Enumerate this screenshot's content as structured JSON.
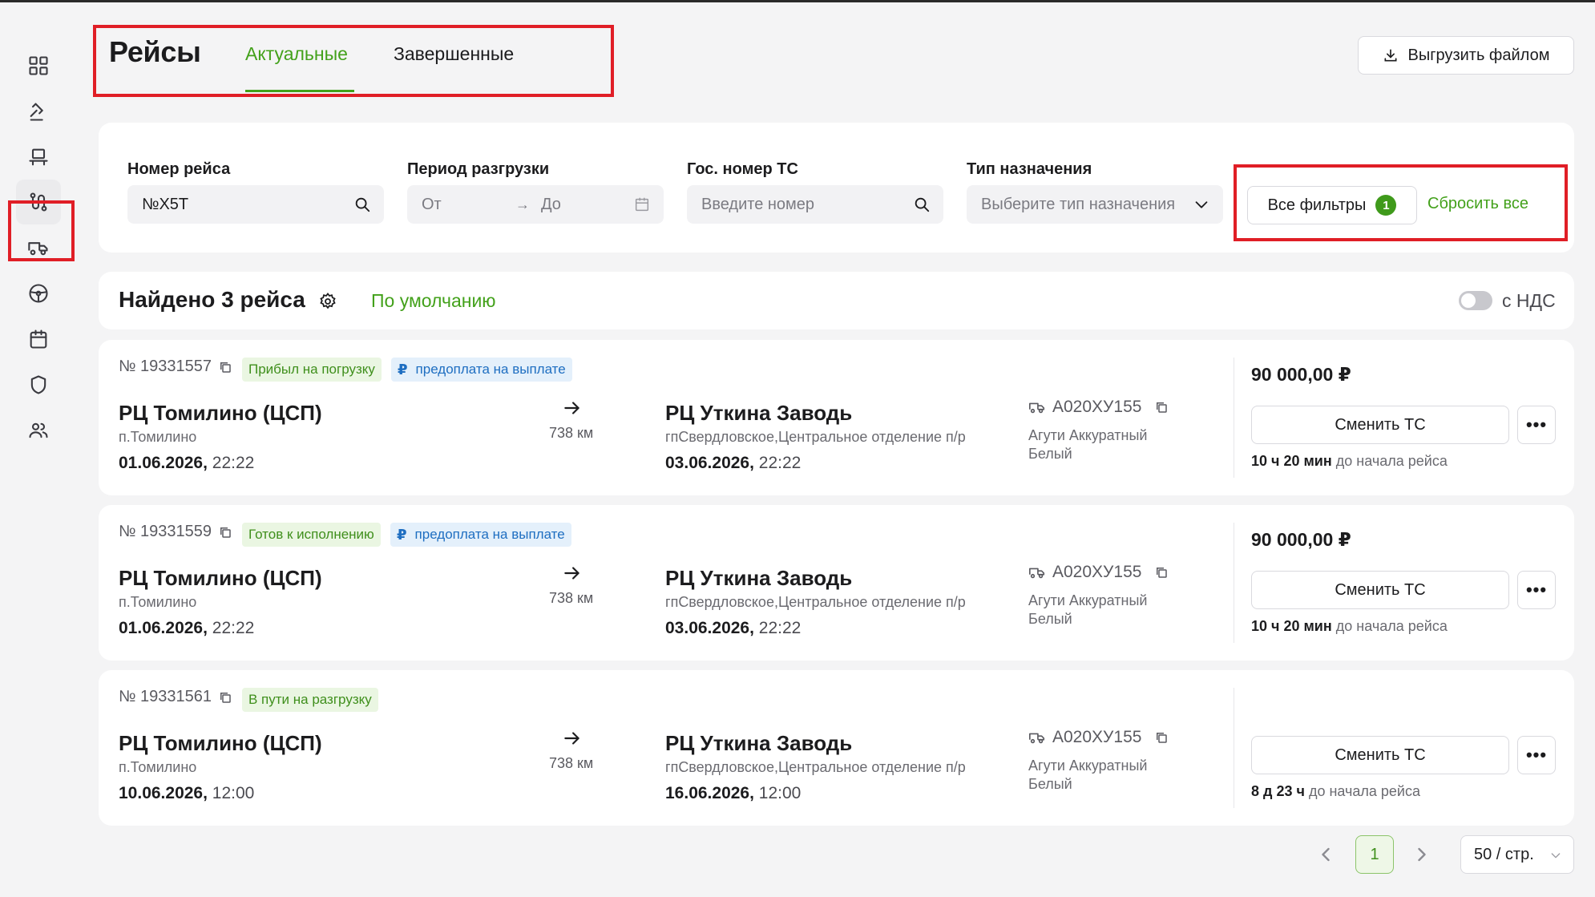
{
  "header": {
    "title": "Рейсы",
    "tabs": [
      {
        "label": "Актуальные",
        "active": true
      },
      {
        "label": "Завершенные",
        "active": false
      }
    ],
    "export_label": "Выгрузить файлом"
  },
  "sidebar": {
    "items": [
      {
        "icon": "dashboard-grid-icon"
      },
      {
        "icon": "auction-gavel-icon"
      },
      {
        "icon": "cargo-platform-icon"
      },
      {
        "icon": "routes-icon",
        "active": true
      },
      {
        "icon": "truck-icon"
      },
      {
        "icon": "steering-wheel-icon"
      },
      {
        "icon": "calendar-icon"
      },
      {
        "icon": "shield-icon"
      },
      {
        "icon": "users-icon"
      }
    ]
  },
  "filters": {
    "trip_number": {
      "label": "Номер рейса",
      "value": "№X5T"
    },
    "period": {
      "label": "Период разгрузки",
      "from_placeholder": "От",
      "to_placeholder": "До"
    },
    "plate": {
      "label": "Гос. номер ТС",
      "placeholder": "Введите номер"
    },
    "assignment": {
      "label": "Тип назначения",
      "placeholder": "Выберите тип назначения"
    },
    "all_filters_label": "Все фильтры",
    "all_filters_count": "1",
    "reset_label": "Сбросить все"
  },
  "results": {
    "found_label": "Найдено 3 рейса",
    "sort_label": "По умолчанию",
    "vat_label": "с НДС",
    "vat_enabled": false
  },
  "trips": [
    {
      "number": "№ 19331557",
      "status": "Прибыл на погрузку",
      "payment": "предоплата на выплате",
      "payment_symbol": "₽",
      "from": {
        "name": "РЦ Томилино (ЦСП)",
        "sub": "п.Томилино",
        "date": "01.06.2026,",
        "time": "22:22"
      },
      "distance": "738 км",
      "to": {
        "name": "РЦ Уткина Заводь",
        "sub": "гпСвердловское,Центральное отделение п/р",
        "date": "03.06.2026,",
        "time": "22:22"
      },
      "plate": "А020ХУ155",
      "truck_model": "Агути Аккуратный Белый",
      "price": "90 000,00 ₽",
      "change_label": "Сменить ТС",
      "more_label": "•••",
      "till_time": "10 ч 20 мин",
      "till_text": "до начала рейса"
    },
    {
      "number": "№ 19331559",
      "status": "Готов к исполнению",
      "payment": "предоплата на выплате",
      "payment_symbol": "₽",
      "from": {
        "name": "РЦ Томилино (ЦСП)",
        "sub": "п.Томилино",
        "date": "01.06.2026,",
        "time": "22:22"
      },
      "distance": "738 км",
      "to": {
        "name": "РЦ Уткина Заводь",
        "sub": "гпСвердловское,Центральное отделение п/р",
        "date": "03.06.2026,",
        "time": "22:22"
      },
      "plate": "А020ХУ155",
      "truck_model": "Агути Аккуратный Белый",
      "price": "90 000,00 ₽",
      "change_label": "Сменить ТС",
      "more_label": "•••",
      "till_time": "10 ч 20 мин",
      "till_text": "до начала рейса"
    },
    {
      "number": "№ 19331561",
      "status": "В пути на разгрузку",
      "payment": "",
      "payment_symbol": "",
      "from": {
        "name": "РЦ Томилино (ЦСП)",
        "sub": "п.Томилино",
        "date": "10.06.2026,",
        "time": "12:00"
      },
      "distance": "738 км",
      "to": {
        "name": "РЦ Уткина Заводь",
        "sub": "гпСвердловское,Центральное отделение п/р",
        "date": "16.06.2026,",
        "time": "12:00"
      },
      "plate": "А020ХУ155",
      "truck_model": "Агути Аккуратный Белый",
      "price": "",
      "change_label": "Сменить ТС",
      "more_label": "•••",
      "till_time": "8 д 23 ч",
      "till_text": "до начала рейса"
    }
  ],
  "pagination": {
    "current_page": "1",
    "page_size_label": "50 / стр."
  },
  "colors": {
    "accent": "#43a11b",
    "highlight_border": "#e01e26",
    "status_green_bg": "#eaf6e2",
    "status_blue_bg": "#e4f0fb"
  }
}
